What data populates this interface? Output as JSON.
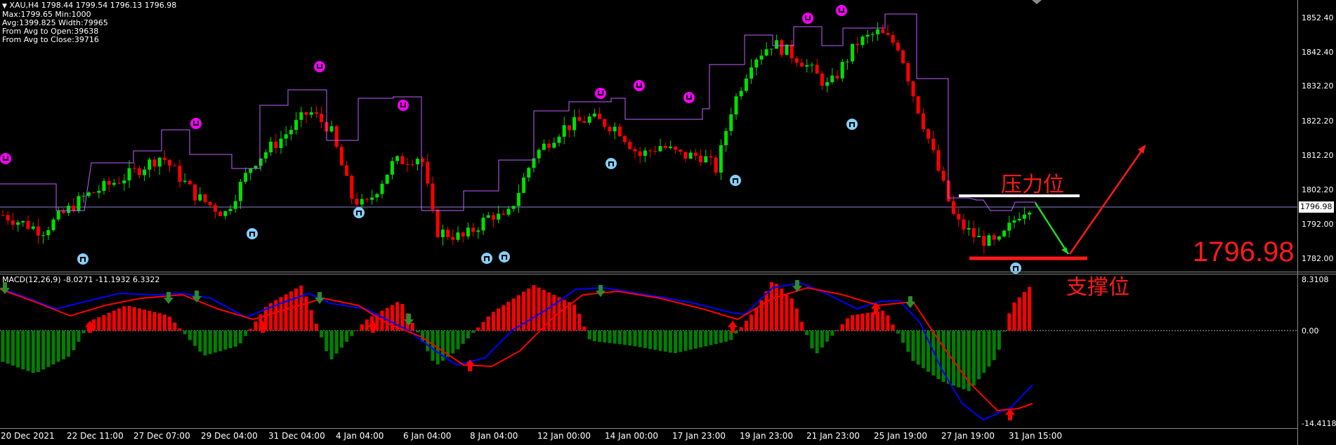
{
  "main_chart": {
    "symbol_line": "XAU,H4  1798.44 1799.54 1796.13 1796.98",
    "stats": [
      "Max:1799.65 Min:1000",
      "Avg:1399.825 Width:79965",
      "From Avg to Open:39638",
      "From Avg to Close:39716"
    ],
    "current_price_label": "1796.98",
    "annotation_big_price": "1796.98",
    "resistance_label": "压力位",
    "support_label": "支撑位",
    "price_axis_labels": [
      "1852.40",
      "1842.40",
      "1832.20",
      "1822.20",
      "1812.20",
      "1802.20",
      "1792.00",
      "1782.00"
    ]
  },
  "macd_panel": {
    "title": "MACD(12,26,9) -8.0271 -11.1932 6.3322",
    "axis_labels": [
      "8.3108",
      "0.00",
      "-14.4118"
    ]
  },
  "time_axis": {
    "labels": [
      "20 Dec 2021",
      "22 Dec 11:00",
      "27 Dec 07:00",
      "29 Dec 04:00",
      "31 Dec 04:00",
      "4 Jan 04:00",
      "6 Jan 04:00",
      "8 Jan 04:00",
      "12 Jan 00:00",
      "14 Jan 00:00",
      "17 Jan 23:00",
      "19 Jan 23:00",
      "21 Jan 23:00",
      "25 Jan 19:00",
      "27 Jan 19:00",
      "31 Jan 15:00"
    ]
  },
  "colors": {
    "bull": "#00e000",
    "bear": "#ff0000",
    "envelope": "#c060ff",
    "macd_main": "#0000ff",
    "macd_signal": "#ff0000",
    "hist_up": "#ff0000",
    "hist_down": "#008000",
    "top_fractal": "#ff00ff",
    "bottom_fractal": "#87cefa"
  }
}
